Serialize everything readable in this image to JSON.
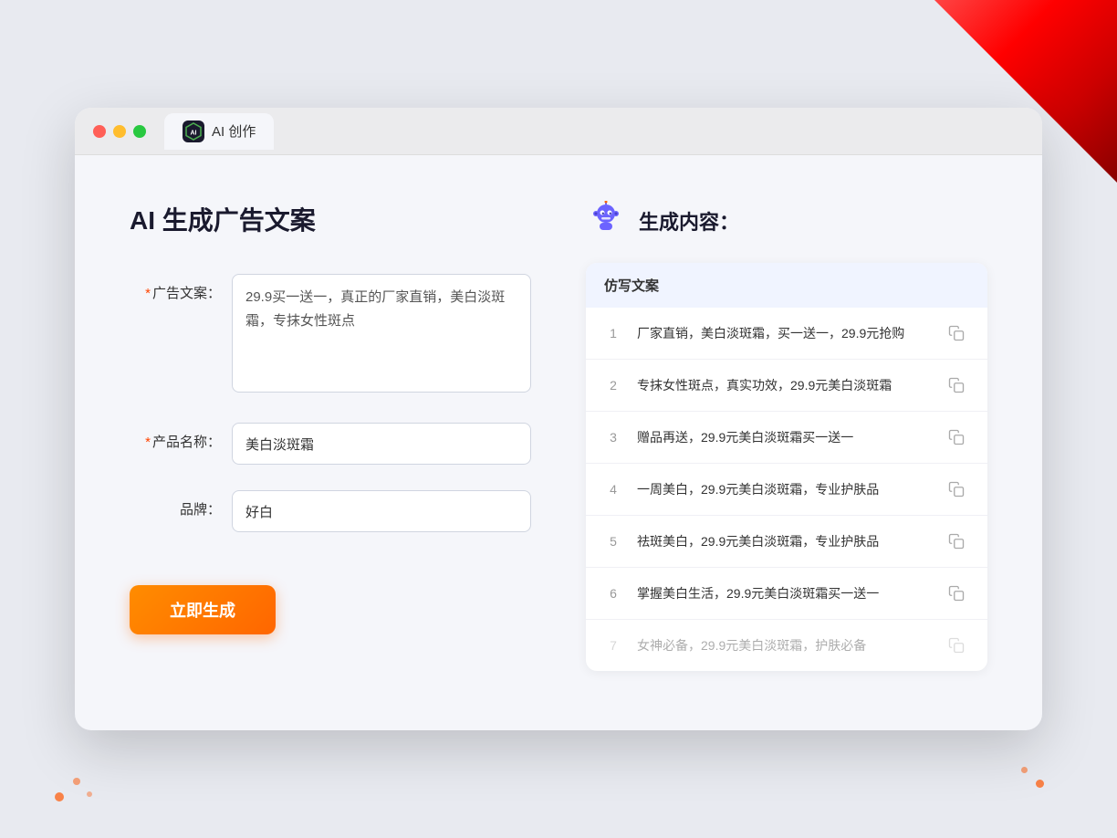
{
  "background": {
    "decoration_label": "bg-top-right"
  },
  "browser": {
    "tab_icon_text": "AI",
    "tab_title": "AI 创作"
  },
  "left_panel": {
    "page_title": "AI 生成广告文案",
    "form": {
      "ad_copy_label": "广告文案：",
      "ad_copy_required": "*",
      "ad_copy_value": "29.9买一送一，真正的厂家直销，美白淡斑霜，专抹女性斑点",
      "product_name_label": "产品名称：",
      "product_name_required": "*",
      "product_name_value": "美白淡斑霜",
      "brand_label": "品牌：",
      "brand_value": "好白"
    },
    "generate_button_label": "立即生成"
  },
  "right_panel": {
    "title": "生成内容：",
    "column_header": "仿写文案",
    "results": [
      {
        "num": "1",
        "text": "厂家直销，美白淡斑霜，买一送一，29.9元抢购"
      },
      {
        "num": "2",
        "text": "专抹女性斑点，真实功效，29.9元美白淡斑霜"
      },
      {
        "num": "3",
        "text": "赠品再送，29.9元美白淡斑霜买一送一"
      },
      {
        "num": "4",
        "text": "一周美白，29.9元美白淡斑霜，专业护肤品"
      },
      {
        "num": "5",
        "text": "祛斑美白，29.9元美白淡斑霜，专业护肤品"
      },
      {
        "num": "6",
        "text": "掌握美白生活，29.9元美白淡斑霜买一送一"
      },
      {
        "num": "7",
        "text": "女神必备，29.9元美白淡斑霜，护肤必备",
        "faded": true
      }
    ]
  }
}
